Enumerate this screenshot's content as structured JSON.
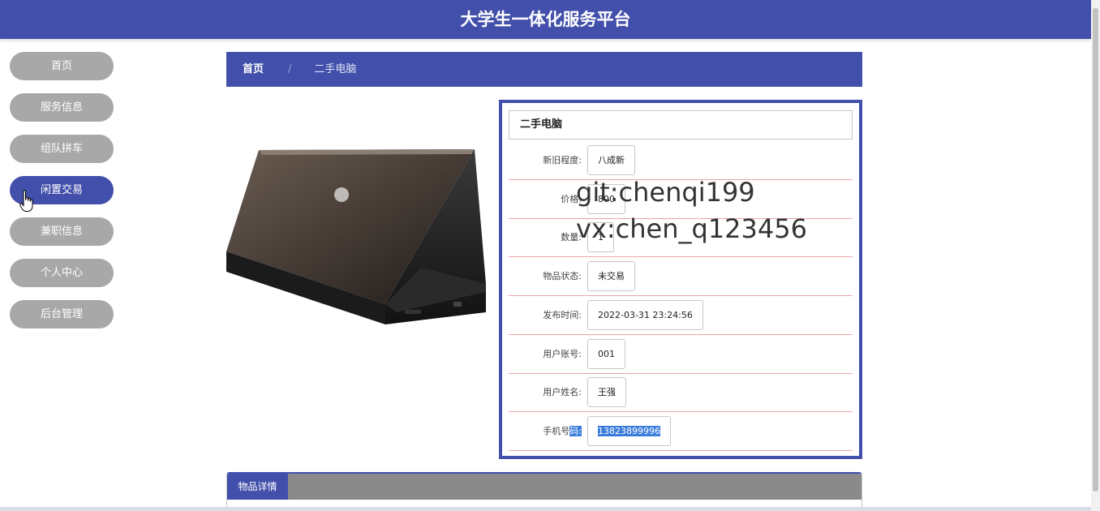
{
  "header": {
    "title": "大学生一体化服务平台"
  },
  "nav": {
    "items": [
      {
        "label": "首页"
      },
      {
        "label": "服务信息"
      },
      {
        "label": "组队拼车"
      },
      {
        "label": "闲置交易"
      },
      {
        "label": "兼职信息"
      },
      {
        "label": "个人中心"
      },
      {
        "label": "后台管理"
      }
    ],
    "active_index": 3
  },
  "breadcrumb": {
    "home": "首页",
    "separator": "/",
    "current": "二手电脑"
  },
  "product": {
    "name": "二手电脑",
    "fields": [
      {
        "label": "新旧程度:",
        "value": "八成新"
      },
      {
        "label": "价格:",
        "value": "800"
      },
      {
        "label": "数量:",
        "value": "1"
      },
      {
        "label": "物品状态:",
        "value": "未交易"
      },
      {
        "label": "发布时间:",
        "value": "2022-03-31 23:24:56"
      },
      {
        "label": "用户账号:",
        "value": "001"
      },
      {
        "label": "用户姓名:",
        "value": "王强"
      },
      {
        "label_prefix": "手机号",
        "label_selected": "码:",
        "value": "13823899996"
      }
    ]
  },
  "watermark": {
    "line1": "git:chenqi199",
    "line2": "vx:chen_q123456"
  },
  "tabs": {
    "active": "物品详情"
  },
  "colors": {
    "primary": "#4350ab",
    "nav_inactive": "#a8a8a8",
    "row_divider": "#e8a8a8"
  }
}
